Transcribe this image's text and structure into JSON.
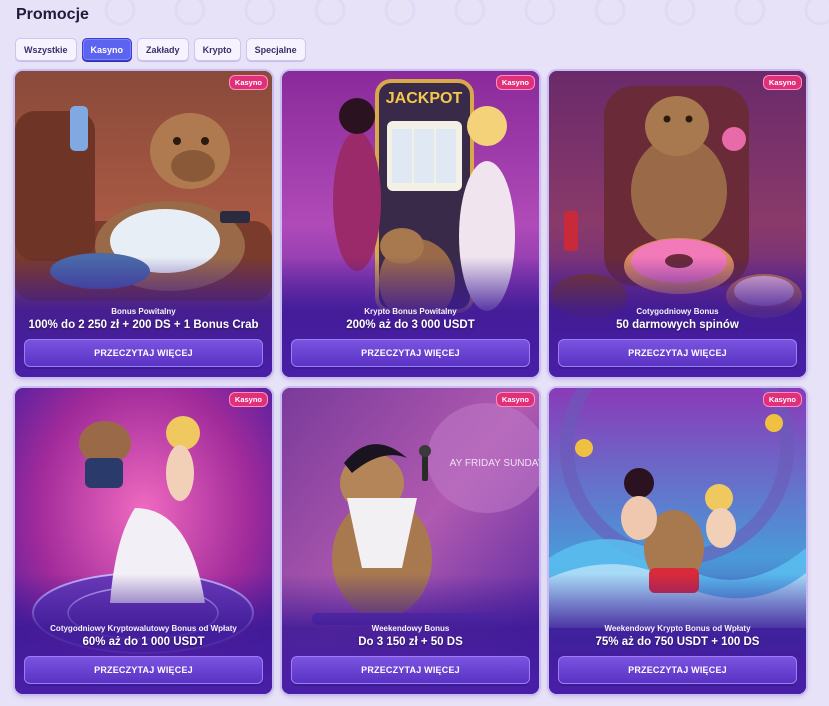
{
  "header": {
    "title": "Promocje"
  },
  "filters": [
    {
      "label": "Wszystkie",
      "active": false
    },
    {
      "label": "Kasyno",
      "active": true
    },
    {
      "label": "Zakłady",
      "active": false
    },
    {
      "label": "Krypto",
      "active": false
    },
    {
      "label": "Specjalne",
      "active": false
    }
  ],
  "cards": [
    {
      "badge": "Kasyno",
      "subtitle": "Bonus Powitalny",
      "title": "100% do 2 250 zł + 200 DS + 1 Bonus Crab",
      "button": "PRZECZYTAJ WIĘCEJ",
      "scene": "capybara-sofa"
    },
    {
      "badge": "Kasyno",
      "subtitle": "Krypto Bonus Powitalny",
      "title": "200% aż do 3 000 USDT",
      "button": "PRZECZYTAJ WIĘCEJ",
      "scene": "jackpot-slot",
      "art_text": "JACKPOT"
    },
    {
      "badge": "Kasyno",
      "subtitle": "Cotygodniowy Bonus",
      "title": "50 darmowych spinów",
      "button": "PRZECZYTAJ WIĘCEJ",
      "scene": "capybara-donuts"
    },
    {
      "badge": "Kasyno",
      "subtitle": "Cotygodniowy Kryptowalutowy Bonus od Wpłaty",
      "title": "60% aż do 1 000 USDT",
      "button": "PRZECZYTAJ WIĘCEJ",
      "scene": "capybara-dance"
    },
    {
      "badge": "Kasyno",
      "subtitle": "Weekendowy Bonus",
      "title": "Do 3 150 zł + 50 DS",
      "button": "PRZECZYTAJ WIĘCEJ",
      "scene": "capybara-singer",
      "art_text": "AY FRIDAY SUNDAY"
    },
    {
      "badge": "Kasyno",
      "subtitle": "Weekendowy Krypto Bonus od Wpłaty",
      "title": "75% aż do 750 USDT + 100 DS",
      "button": "PRZECZYTAJ WIĘCEJ",
      "scene": "capybara-wave"
    }
  ],
  "colors": {
    "accent": "#5c63f0",
    "badge": "#e0307a",
    "card_base": "#4a1fa8",
    "page_bg": "#e7e2f8"
  }
}
